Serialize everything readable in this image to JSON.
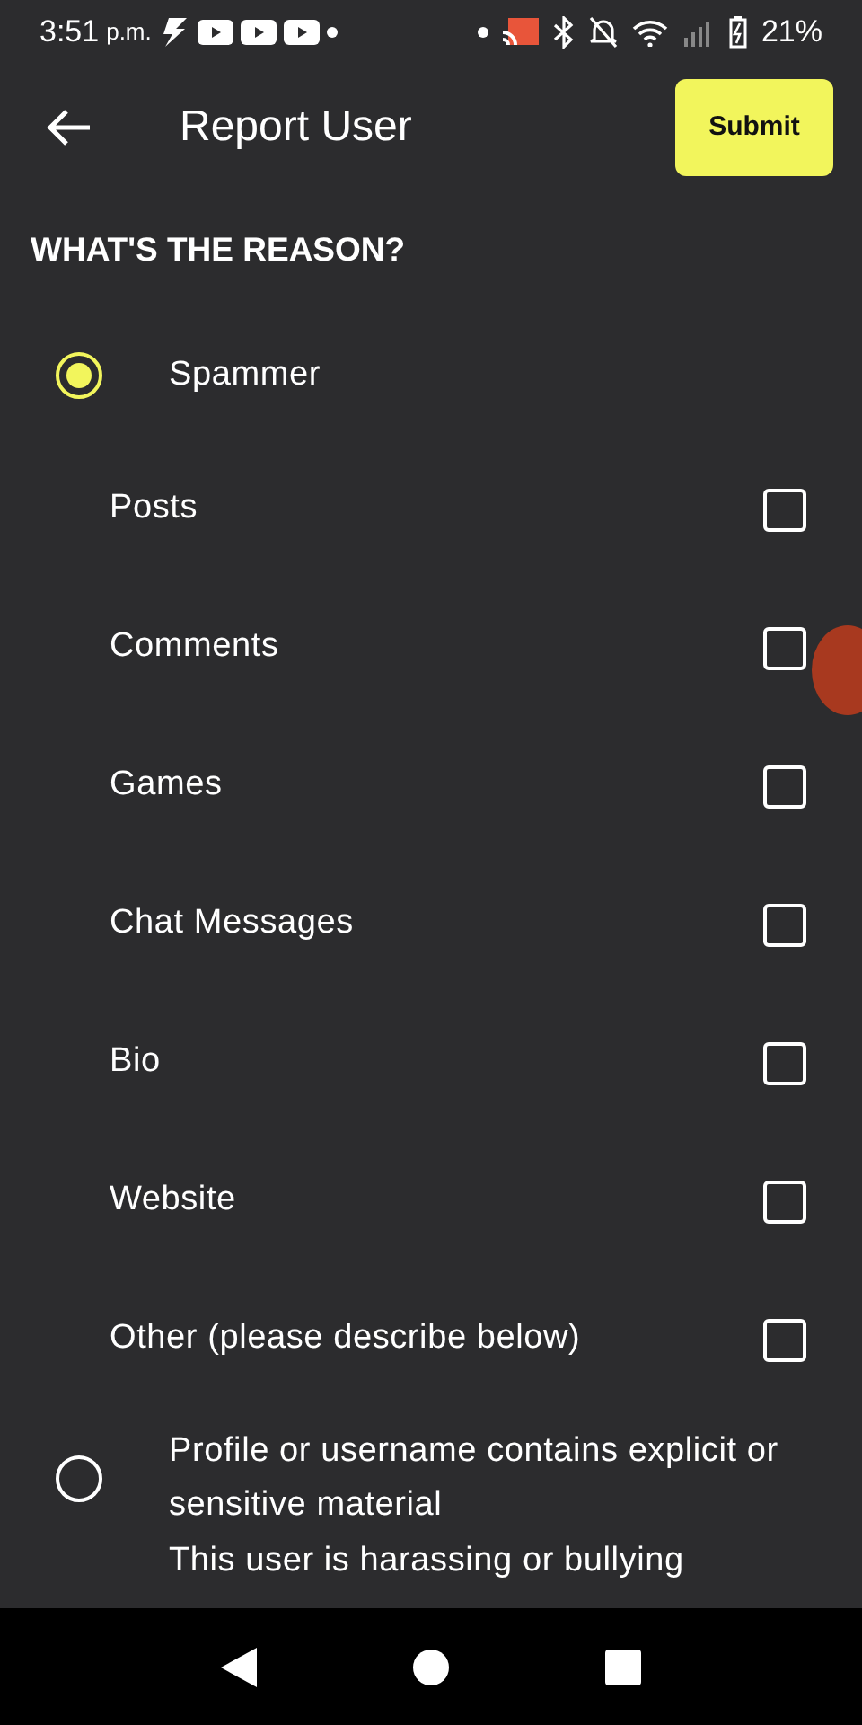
{
  "status_bar": {
    "time": "3:51",
    "time_suffix": "p.m.",
    "battery": "21%"
  },
  "header": {
    "title": "Report User",
    "submit": "Submit"
  },
  "section_title": "WHAT'S THE REASON?",
  "reasons": [
    {
      "label": "Spammer",
      "selected": true,
      "sub_options": [
        {
          "label": "Posts",
          "checked": false
        },
        {
          "label": "Comments",
          "checked": false
        },
        {
          "label": "Games",
          "checked": false
        },
        {
          "label": "Chat Messages",
          "checked": false
        },
        {
          "label": "Bio",
          "checked": false
        },
        {
          "label": "Website",
          "checked": false
        },
        {
          "label": "Other (please describe below)",
          "checked": false
        }
      ]
    },
    {
      "label": "Profile or username contains explicit or sensitive material",
      "selected": false
    },
    {
      "label": "This user is harassing or bullying"
    }
  ]
}
